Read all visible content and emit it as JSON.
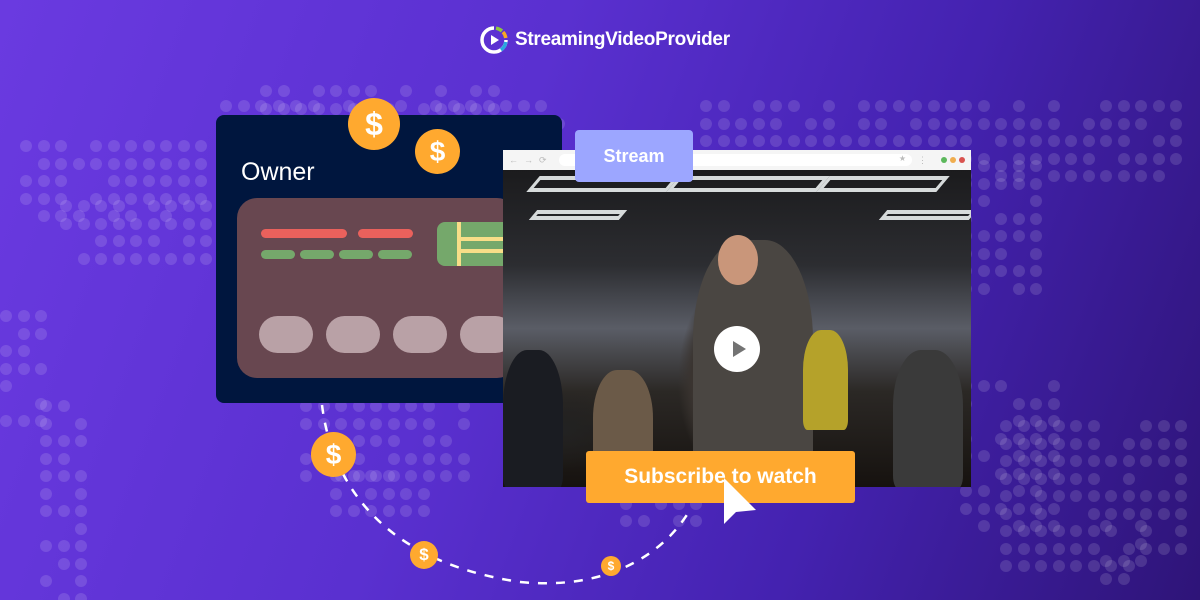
{
  "brand": {
    "name": "StreamingVideoProvider",
    "logo_icon": "play-ring-icon"
  },
  "owner_panel": {
    "title": "Owner",
    "card_icon": "credit-card-icon"
  },
  "browser": {
    "tab_label": "Stream",
    "nav_icons": [
      "back-arrow-icon",
      "forward-arrow-icon",
      "reload-icon"
    ],
    "window_dots": [
      "#5cb85c",
      "#f0ad4e",
      "#d9534f"
    ]
  },
  "video": {
    "play_icon": "play-icon",
    "scene": "presenter-speaking-to-audience"
  },
  "cta": {
    "label": "Subscribe to watch",
    "cursor_icon": "mouse-pointer-icon"
  },
  "coins": {
    "symbol": "$",
    "icon": "dollar-coin-icon"
  },
  "colors": {
    "background": "#5a30d0",
    "owner_panel": "#00163e",
    "card": "#684750",
    "accent_orange": "#ffa92f",
    "stream_tab": "#9ca6ff"
  }
}
